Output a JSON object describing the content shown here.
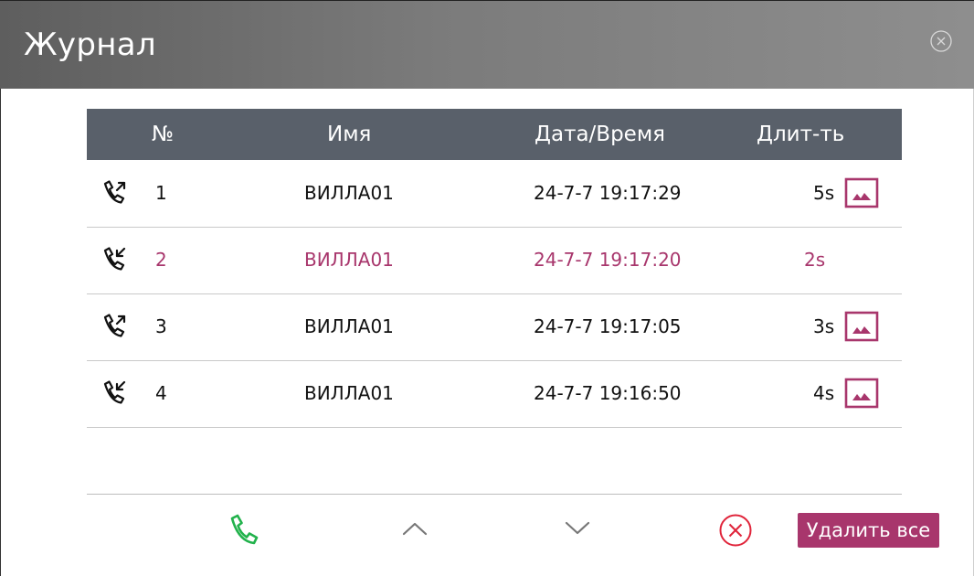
{
  "header": {
    "title": "Журнал",
    "close_icon": "close-circle-icon"
  },
  "table": {
    "columns": {
      "no": "№",
      "name": "Имя",
      "datetime": "Дата/Время",
      "duration": "Длит-ть"
    },
    "rows": [
      {
        "direction": "outgoing",
        "direction_icon": "outgoing-call-icon",
        "no": "1",
        "name": "ВИЛЛА01",
        "datetime": "24-7-7 19:17:29",
        "duration": "5s",
        "has_image": true
      },
      {
        "direction": "incoming",
        "direction_icon": "incoming-call-icon",
        "no": "2",
        "name": "ВИЛЛА01",
        "datetime": "24-7-7 19:17:20",
        "duration": "2s",
        "has_image": false,
        "selected": true
      },
      {
        "direction": "outgoing",
        "direction_icon": "outgoing-call-icon",
        "no": "3",
        "name": "ВИЛЛА01",
        "datetime": "24-7-7 19:17:05",
        "duration": "3s",
        "has_image": true
      },
      {
        "direction": "incoming",
        "direction_icon": "incoming-call-icon",
        "no": "4",
        "name": "ВИЛЛА01",
        "datetime": "24-7-7 19:16:50",
        "duration": "4s",
        "has_image": true
      }
    ]
  },
  "toolbar": {
    "call_icon": "phone-icon",
    "up_icon": "chevron-up-icon",
    "down_icon": "chevron-down-icon",
    "delete_icon": "delete-circle-icon",
    "delete_all_label": "Удалить все"
  },
  "colors": {
    "accent": "#a8366c",
    "call_green": "#22b24c",
    "delete_red": "#e0243a",
    "header_bg": "#6e6e6e",
    "table_header_bg": "#59606a"
  }
}
